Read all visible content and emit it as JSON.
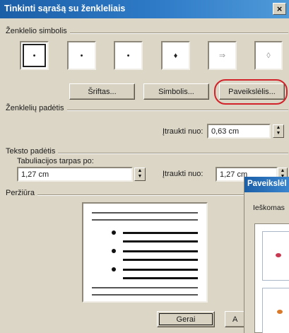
{
  "window": {
    "title": "Tinkinti sąrašą su ženkleliais",
    "close_glyph": "×"
  },
  "bullet_section": {
    "label": "Ženklelio simbolis",
    "symbols": [
      "•",
      "•",
      "•",
      "♦",
      "⇒",
      "◊"
    ],
    "selected_index": 0,
    "font_button": "Šriftas...",
    "symbol_button": "Simbolis...",
    "picture_button": "Paveikslėlis...",
    "highlight_color": "#d2232a"
  },
  "bullet_position": {
    "label": "Ženklelių padėtis",
    "indent_label": "Įtraukti nuo:",
    "indent_value": "0,63 cm"
  },
  "text_position": {
    "label": "Teksto padėtis",
    "tab_label": "Tabuliacijos tarpas po:",
    "tab_value": "1,27 cm",
    "indent_label": "Įtraukti nuo:",
    "indent_value": "1,27 cm"
  },
  "preview": {
    "label": "Peržiūra"
  },
  "footer": {
    "ok_button": "Gerai",
    "cancel_partial": "A"
  },
  "picture_dialog": {
    "title": "Paveikslėl",
    "search_label": "Ieškomas"
  },
  "colors": {
    "titlebar": "#1b5fa7",
    "dialog_bg": "#dcd6c6"
  }
}
